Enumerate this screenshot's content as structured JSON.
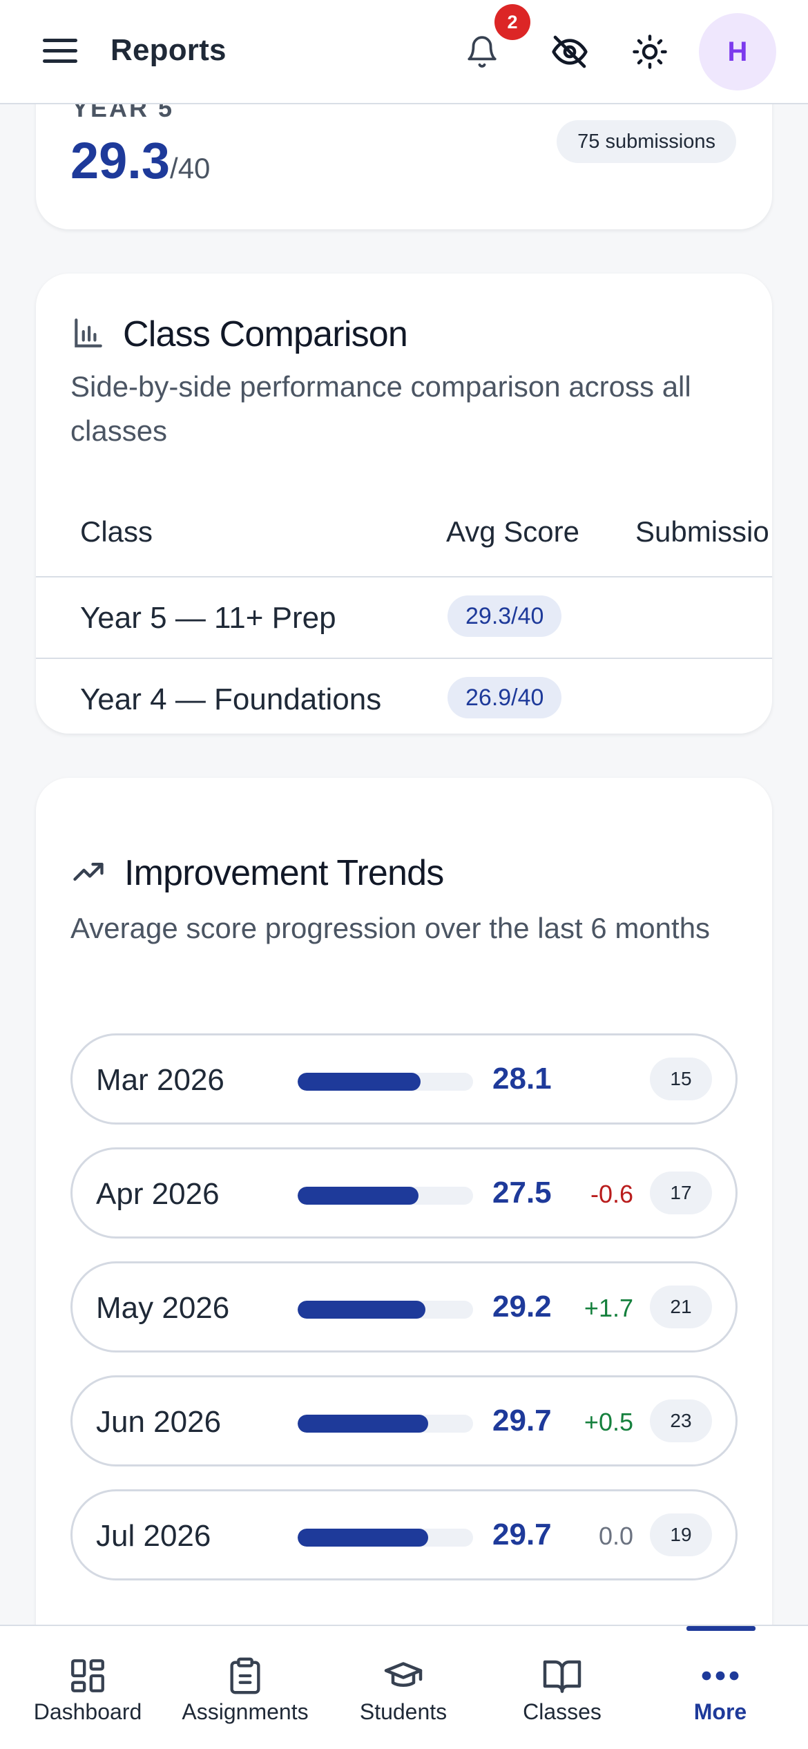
{
  "header": {
    "title": "Reports",
    "notification_count": "2",
    "avatar_initial": "H",
    "icons": [
      "menu-icon",
      "bell-icon",
      "eye-off-icon",
      "sun-icon"
    ]
  },
  "summary_card": {
    "label": "YEAR 5",
    "score": "29.3",
    "max": "/40",
    "submissions": "75 submissions"
  },
  "class_comparison": {
    "title": "Class Comparison",
    "description": "Side-by-side performance comparison across all classes",
    "columns": [
      "Class",
      "Avg Score",
      "Submissio"
    ],
    "rows": [
      {
        "class": "Year 5 — 11+ Prep",
        "avg": "29.3/40"
      },
      {
        "class": "Year 4 — Foundations",
        "avg": "26.9/40"
      }
    ]
  },
  "trends": {
    "title": "Improvement Trends",
    "description": "Average score progression over the last 6 months",
    "rows": [
      {
        "month": "Mar 2026",
        "value": "28.1",
        "change": "",
        "count": "15",
        "progress": 0.7025,
        "dir": "flat"
      },
      {
        "month": "Apr 2026",
        "value": "27.5",
        "change": "-0.6",
        "count": "17",
        "progress": 0.6875,
        "dir": "down"
      },
      {
        "month": "May 2026",
        "value": "29.2",
        "change": "+1.7",
        "count": "21",
        "progress": 0.73,
        "dir": "up"
      },
      {
        "month": "Jun 2026",
        "value": "29.7",
        "change": "+0.5",
        "count": "23",
        "progress": 0.7425,
        "dir": "up"
      },
      {
        "month": "Jul 2026",
        "value": "29.7",
        "change": "0.0",
        "count": "19",
        "progress": 0.7425,
        "dir": "flat"
      }
    ]
  },
  "bottom_nav": {
    "items": [
      {
        "label": "Dashboard",
        "icon": "grid-icon"
      },
      {
        "label": "Assignments",
        "icon": "clipboard-icon"
      },
      {
        "label": "Students",
        "icon": "graduation-cap-icon"
      },
      {
        "label": "Classes",
        "icon": "book-icon"
      },
      {
        "label": "More",
        "icon": "more-dots-icon"
      }
    ],
    "active": "More"
  },
  "colors": {
    "accent": "#1e3a9a",
    "badge": "#dc2626",
    "avatar_bg": "#efe7fd",
    "avatar_text": "#7c3aed",
    "negative": "#b91c1c",
    "positive": "#15803d"
  }
}
